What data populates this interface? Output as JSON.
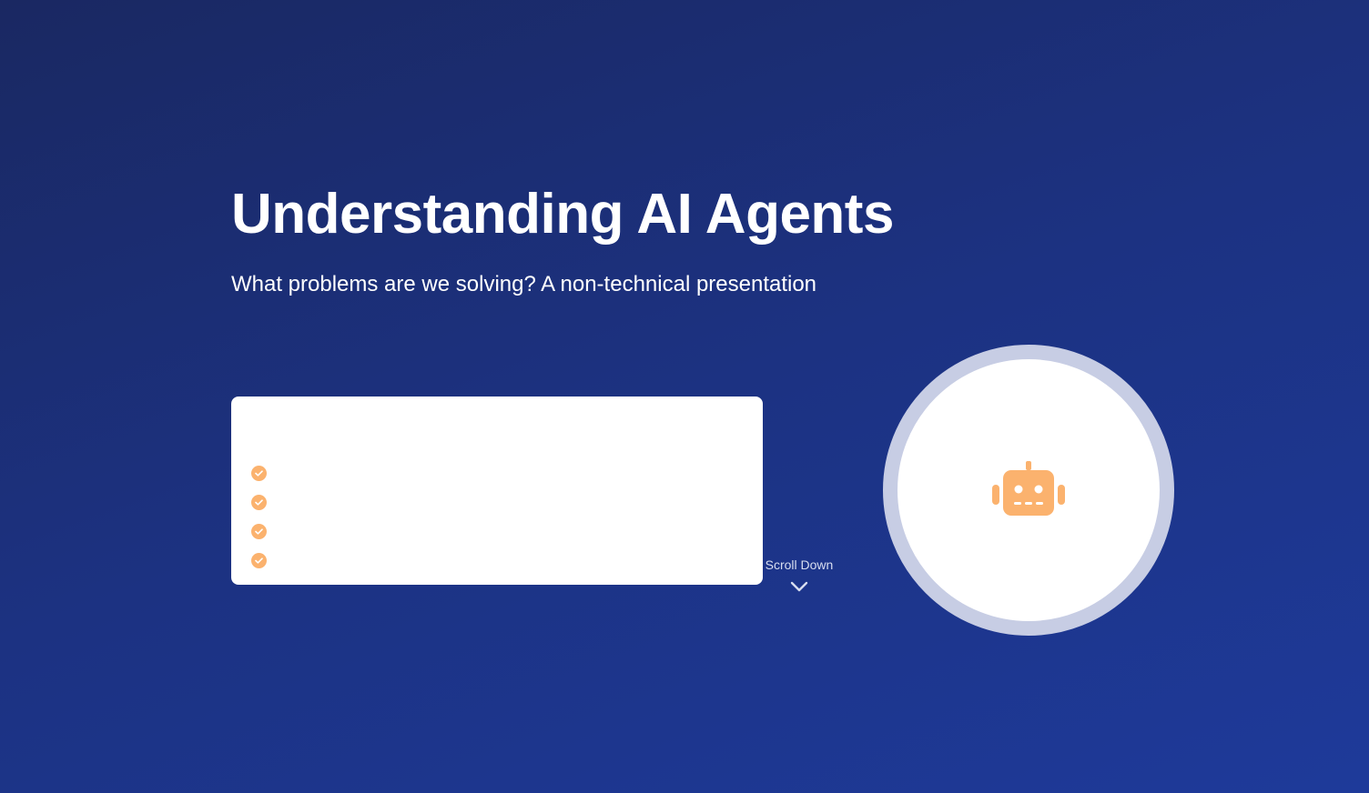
{
  "hero": {
    "title": "Understanding AI Agents",
    "subtitle": "What problems are we solving? A non-technical presentation"
  },
  "card": {
    "heading": "",
    "items": [
      {
        "text": ""
      },
      {
        "text": ""
      },
      {
        "text": ""
      },
      {
        "text": ""
      }
    ]
  },
  "scroll": {
    "label": "Scroll Down"
  },
  "icons": {
    "check": "check-circle-icon",
    "scroll": "chevron-down-icon",
    "illustration": "robot-icon"
  },
  "colors": {
    "background_start": "#1a2862",
    "background_end": "#1e3a9a",
    "accent": "#fbb26e",
    "circle_ring": "#c7cde4"
  }
}
